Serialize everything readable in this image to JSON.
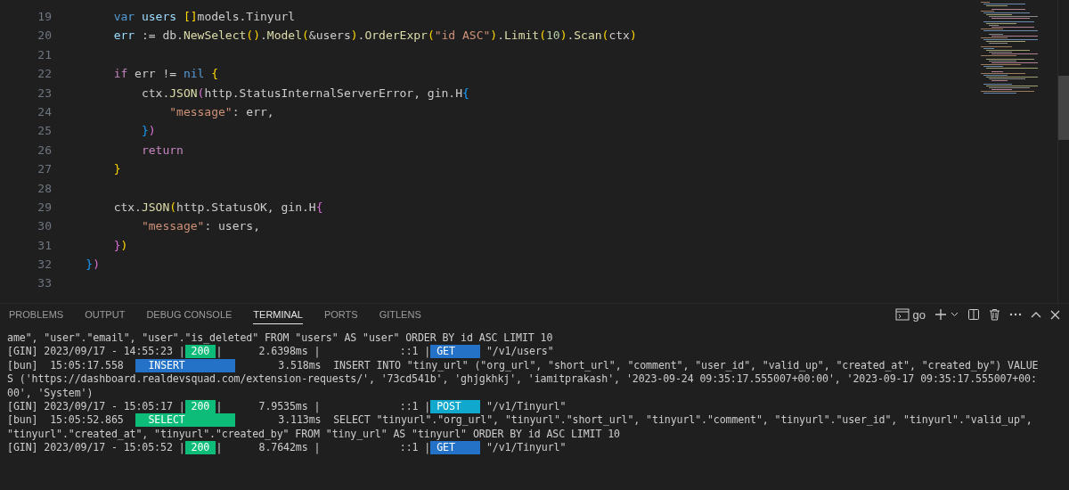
{
  "editor": {
    "lines": [
      {
        "number": "19",
        "tokens": [
          {
            "text": "        var ",
            "kind": "keyword"
          },
          {
            "text": "users ",
            "kind": "variable"
          },
          {
            "text": "[]",
            "kind": "bracket1"
          },
          {
            "text": "models.Tinyurl",
            "kind": "plain"
          }
        ]
      },
      {
        "number": "20",
        "tokens": [
          {
            "text": "        err",
            "kind": "variable"
          },
          {
            "text": " := db.",
            "kind": "plain"
          },
          {
            "text": "NewSelect",
            "kind": "function"
          },
          {
            "text": "()",
            "kind": "bracket1"
          },
          {
            "text": ".",
            "kind": "plain"
          },
          {
            "text": "Model",
            "kind": "function"
          },
          {
            "text": "(",
            "kind": "bracket1"
          },
          {
            "text": "&users",
            "kind": "plain"
          },
          {
            "text": ")",
            "kind": "bracket1"
          },
          {
            "text": ".",
            "kind": "plain"
          },
          {
            "text": "OrderExpr",
            "kind": "function"
          },
          {
            "text": "(",
            "kind": "bracket1"
          },
          {
            "text": "\"id ASC\"",
            "kind": "string"
          },
          {
            "text": ")",
            "kind": "bracket1"
          },
          {
            "text": ".",
            "kind": "plain"
          },
          {
            "text": "Limit",
            "kind": "function"
          },
          {
            "text": "(",
            "kind": "bracket1"
          },
          {
            "text": "10",
            "kind": "number"
          },
          {
            "text": ")",
            "kind": "bracket1"
          },
          {
            "text": ".",
            "kind": "plain"
          },
          {
            "text": "Scan",
            "kind": "function"
          },
          {
            "text": "(",
            "kind": "bracket1"
          },
          {
            "text": "ctx",
            "kind": "plain"
          },
          {
            "text": ")",
            "kind": "bracket1"
          }
        ]
      },
      {
        "number": "21"
      },
      {
        "number": "22",
        "tokens": [
          {
            "text": "        if",
            "kind": "control"
          },
          {
            "text": " err != ",
            "kind": "plain"
          },
          {
            "text": "nil ",
            "kind": "keyword"
          },
          {
            "text": "{",
            "kind": "bracket1"
          }
        ]
      },
      {
        "number": "23",
        "tokens": [
          {
            "text": "            ctx.",
            "kind": "plain"
          },
          {
            "text": "JSON",
            "kind": "function"
          },
          {
            "text": "(",
            "kind": "bracket2"
          },
          {
            "text": "http.StatusInternalServerError, gin.H",
            "kind": "plain"
          },
          {
            "text": "{",
            "kind": "bracket3"
          }
        ]
      },
      {
        "number": "24",
        "tokens": [
          {
            "text": "                \"message\"",
            "kind": "string"
          },
          {
            "text": ": err,",
            "kind": "plain"
          }
        ]
      },
      {
        "number": "25",
        "tokens": [
          {
            "text": "            }",
            "kind": "bracket3"
          },
          {
            "text": ")",
            "kind": "bracket2"
          }
        ]
      },
      {
        "number": "26",
        "tokens": [
          {
            "text": "            return",
            "kind": "control"
          }
        ]
      },
      {
        "number": "27",
        "tokens": [
          {
            "text": "        }",
            "kind": "bracket1"
          }
        ]
      },
      {
        "number": "28"
      },
      {
        "number": "29",
        "tokens": [
          {
            "text": "        ctx.",
            "kind": "plain"
          },
          {
            "text": "JSON",
            "kind": "function"
          },
          {
            "text": "(",
            "kind": "bracket1"
          },
          {
            "text": "http.StatusOK, gin.H",
            "kind": "plain"
          },
          {
            "text": "{",
            "kind": "bracket2"
          }
        ]
      },
      {
        "number": "30",
        "tokens": [
          {
            "text": "            \"message\"",
            "kind": "string"
          },
          {
            "text": ": users,",
            "kind": "plain"
          }
        ]
      },
      {
        "number": "31",
        "tokens": [
          {
            "text": "        }",
            "kind": "bracket2"
          },
          {
            "text": ")",
            "kind": "bracket1"
          }
        ]
      },
      {
        "number": "32",
        "tokens": [
          {
            "text": "    }",
            "kind": "bracket3"
          },
          {
            "text": ")",
            "kind": "bracket2"
          }
        ]
      },
      {
        "number": "33"
      }
    ]
  },
  "panel": {
    "tabs": [
      {
        "label": "PROBLEMS",
        "selected": false
      },
      {
        "label": "OUTPUT",
        "selected": false
      },
      {
        "label": "DEBUG CONSOLE",
        "selected": false
      },
      {
        "label": "TERMINAL",
        "selected": true
      },
      {
        "label": "PORTS",
        "selected": false
      },
      {
        "label": "GITLENS",
        "selected": false
      }
    ],
    "terminal_name": "go",
    "terminal": [
      {
        "segments": [
          {
            "kind": "text",
            "text": "ame\", \"user\".\"email\", \"user\".\"is_deleted\" FROM \"users\" AS \"user\" ORDER BY id ASC LIMIT 10"
          }
        ]
      },
      {
        "segments": [
          {
            "kind": "text",
            "text": "[GIN] 2023/09/17 - 14:55:23 |"
          },
          {
            "kind": "status_badge",
            "color": "#0dbc79",
            "text": "200"
          },
          {
            "kind": "text",
            "text": "|      2.6398ms |             ::1 |"
          },
          {
            "kind": "method_badge",
            "color": "#2472c8",
            "text": "GET"
          },
          {
            "kind": "text",
            "text": " \"/v1/users\""
          }
        ]
      },
      {
        "segments": [
          {
            "kind": "text",
            "text": "[bun]  15:05:17.558  "
          },
          {
            "kind": "query_badge",
            "color": "#2472c8",
            "text": "INSERT"
          },
          {
            "kind": "text",
            "text": "       3.518ms  INSERT INTO \"tiny_url\" (\"org_url\", \"short_url\", \"comment\", \"user_id\", \"valid_up\", \"created_at\", \"created_by\") VALUE"
          }
        ]
      },
      {
        "segments": [
          {
            "kind": "text",
            "text": "S ('https://dashboard.realdevsquad.com/extension-requests/', '73cd541b', 'ghjgkhkj', 'iamitprakash', '2023-09-24 09:35:17.555007+00:00', '2023-09-17 09:35:17.555007+00:"
          }
        ]
      },
      {
        "segments": [
          {
            "kind": "text",
            "text": "00', 'System')"
          }
        ]
      },
      {
        "segments": [
          {
            "kind": "text",
            "text": "[GIN] 2023/09/17 - 15:05:17 |"
          },
          {
            "kind": "status_badge",
            "color": "#0dbc79",
            "text": "200"
          },
          {
            "kind": "text",
            "text": "|      7.9535ms |             ::1 |"
          },
          {
            "kind": "method_badge",
            "color": "#11a8cd",
            "text": "POST"
          },
          {
            "kind": "text",
            "text": " \"/v1/Tinyurl\""
          }
        ]
      },
      {
        "segments": [
          {
            "kind": "text",
            "text": "[bun]  15:05:52.865  "
          },
          {
            "kind": "query_badge",
            "color": "#0dbc79",
            "text": "SELECT"
          },
          {
            "kind": "text",
            "text": "       3.113ms  SELECT \"tinyurl\".\"org_url\", \"tinyurl\".\"short_url\", \"tinyurl\".\"comment\", \"tinyurl\".\"user_id\", \"tinyurl\".\"valid_up\","
          }
        ]
      },
      {
        "segments": [
          {
            "kind": "text",
            "text": "\"tinyurl\".\"created_at\", \"tinyurl\".\"created_by\" FROM \"tiny_url\" AS \"tinyurl\" ORDER BY id ASC LIMIT 10"
          }
        ]
      },
      {
        "segments": [
          {
            "kind": "text",
            "text": "[GIN] 2023/09/17 - 15:05:52 |"
          },
          {
            "kind": "status_badge",
            "color": "#0dbc79",
            "text": "200"
          },
          {
            "kind": "text",
            "text": "|      8.7642ms |             ::1 |"
          },
          {
            "kind": "method_badge",
            "color": "#2472c8",
            "text": "GET"
          },
          {
            "kind": "text",
            "text": " \"/v1/Tinyurl\""
          }
        ]
      }
    ]
  }
}
